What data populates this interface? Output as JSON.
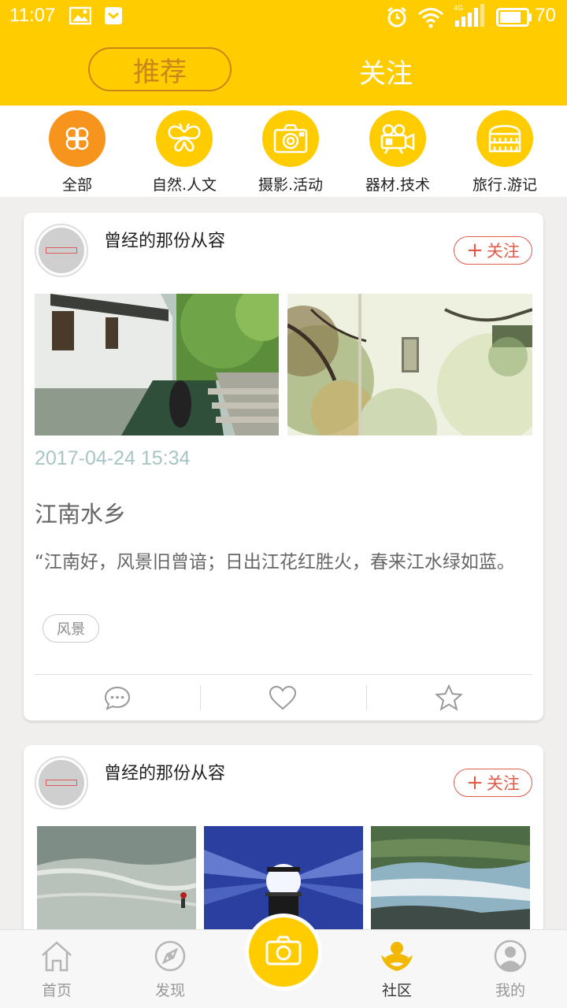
{
  "status_bar": {
    "time": "11:07",
    "battery": "70",
    "network": "4G"
  },
  "header": {
    "tabs": [
      {
        "label": "推荐",
        "active": true
      },
      {
        "label": "关注",
        "active": false
      }
    ]
  },
  "categories": [
    {
      "label": "全部",
      "icon": "clover-icon",
      "active": true
    },
    {
      "label": "自然.人文",
      "icon": "butterfly-icon",
      "active": false
    },
    {
      "label": "摄影.活动",
      "icon": "camera-icon",
      "active": false
    },
    {
      "label": "器材.技术",
      "icon": "movie-camera-icon",
      "active": false
    },
    {
      "label": "旅行.游记",
      "icon": "colosseum-icon",
      "active": false
    }
  ],
  "posts": [
    {
      "username": "曾经的那份从容",
      "follow_label": "关注",
      "time": "2017-04-24 15:34",
      "title": "江南水乡",
      "excerpt": "“江南好，风景旧曾谙；日出江花红胜火，春来江水绿如蓝。",
      "tag": "风景"
    },
    {
      "username": "曾经的那份从容",
      "follow_label": "关注"
    }
  ],
  "bottom_nav": [
    {
      "label": "首页",
      "icon": "home-icon",
      "active": false
    },
    {
      "label": "发现",
      "icon": "compass-icon",
      "active": false
    },
    {
      "label": "社区",
      "icon": "community-icon",
      "active": true
    },
    {
      "label": "我的",
      "icon": "profile-icon",
      "active": false
    }
  ],
  "colors": {
    "brand_yellow": "#ffcc00",
    "active_orange": "#f7941d",
    "follow_red": "#e05a4a",
    "time_teal": "#a8c4c4"
  }
}
